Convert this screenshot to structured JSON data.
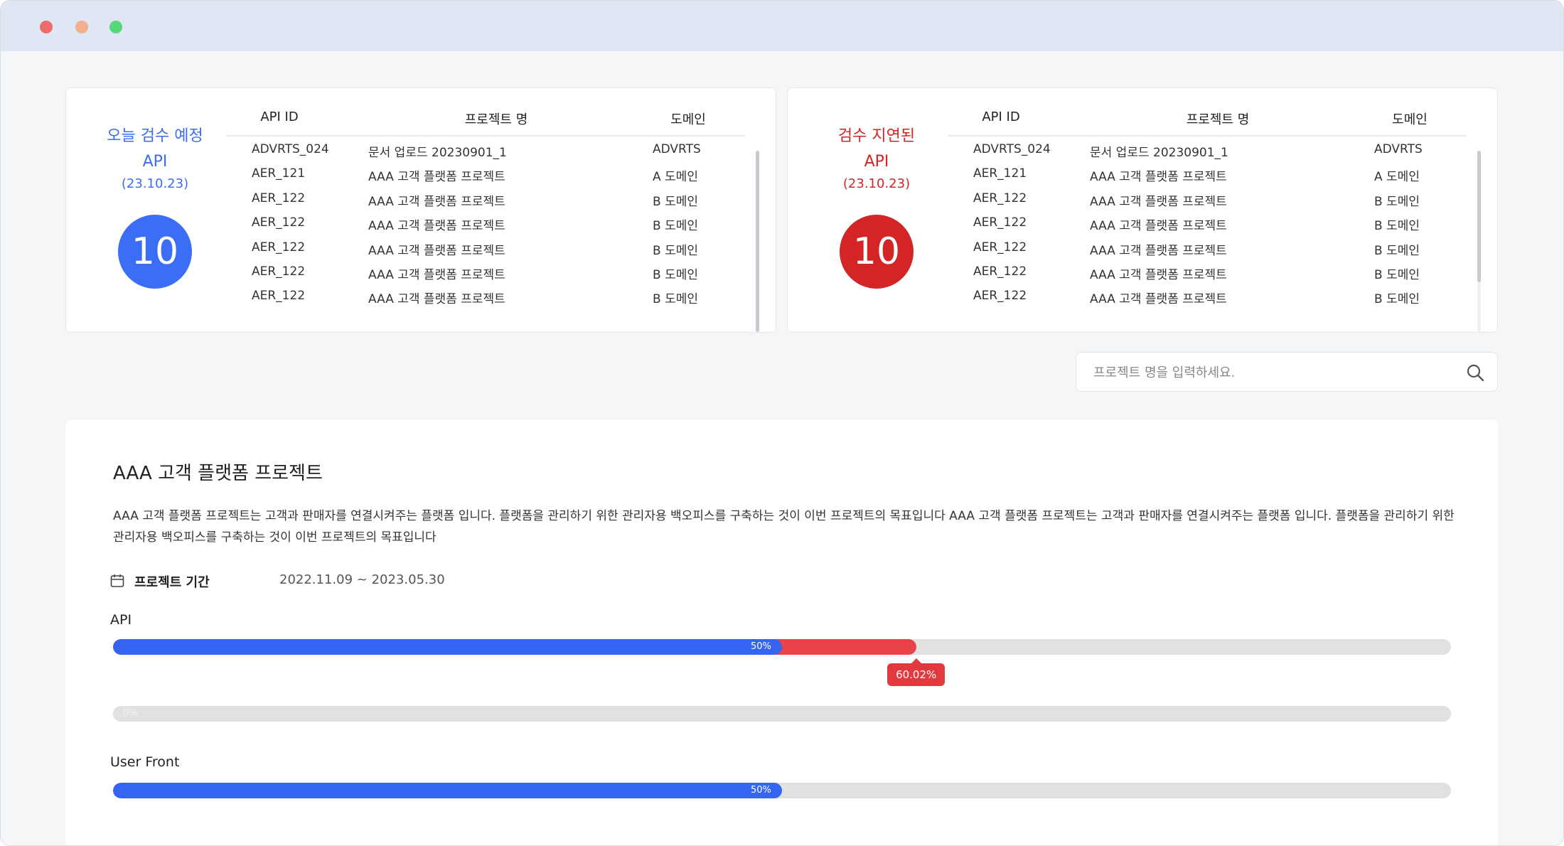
{
  "window": {
    "controls": {
      "close_color": "#ee6b6b",
      "minimize_color": "#f3b08c",
      "maximize_color": "#55d97a"
    }
  },
  "colors": {
    "blue": "#3b6ef5",
    "red": "#d32426"
  },
  "table_headers": {
    "api_id": "API ID",
    "project_name": "프로젝트 명",
    "domain": "도메인"
  },
  "scheduled_card": {
    "label_line1": "오늘 검수 예정",
    "label_line2": "API",
    "date": "(23.10.23)",
    "count": "10",
    "rows": [
      {
        "api_id": "ADVRTS_024",
        "project": "문서 업로드 20230901_1",
        "domain": "ADVRTS"
      },
      {
        "api_id": "AER_121",
        "project": "AAA 고객 플랫폼 프로젝트",
        "domain": "A 도메인"
      },
      {
        "api_id": "AER_122",
        "project": "AAA 고객 플랫폼 프로젝트",
        "domain": "B 도메인"
      },
      {
        "api_id": "AER_122",
        "project": "AAA 고객 플랫폼 프로젝트",
        "domain": "B 도메인"
      },
      {
        "api_id": "AER_122",
        "project": "AAA 고객 플랫폼 프로젝트",
        "domain": "B 도메인"
      },
      {
        "api_id": "AER_122",
        "project": "AAA 고객 플랫폼 프로젝트",
        "domain": "B 도메인"
      },
      {
        "api_id": "AER_122",
        "project": "AAA 고객 플랫폼 프로젝트",
        "domain": "B 도메인"
      }
    ]
  },
  "delayed_card": {
    "label_line1": "검수 지연된",
    "label_line2": "API",
    "date": "(23.10.23)",
    "count": "10",
    "rows": [
      {
        "api_id": "ADVRTS_024",
        "project": "문서 업로드 20230901_1",
        "domain": "ADVRTS"
      },
      {
        "api_id": "AER_121",
        "project": "AAA 고객 플랫폼 프로젝트",
        "domain": "A 도메인"
      },
      {
        "api_id": "AER_122",
        "project": "AAA 고객 플랫폼 프로젝트",
        "domain": "B 도메인"
      },
      {
        "api_id": "AER_122",
        "project": "AAA 고객 플랫폼 프로젝트",
        "domain": "B 도메인"
      },
      {
        "api_id": "AER_122",
        "project": "AAA 고객 플랫폼 프로젝트",
        "domain": "B 도메인"
      },
      {
        "api_id": "AER_122",
        "project": "AAA 고객 플랫폼 프로젝트",
        "domain": "B 도메인"
      },
      {
        "api_id": "AER_122",
        "project": "AAA 고객 플랫폼 프로젝트",
        "domain": "B 도메인"
      }
    ]
  },
  "search": {
    "placeholder": "프로젝트 명을 입력하세요.",
    "icon": "search-icon"
  },
  "project": {
    "title": "AAA 고객 플랫폼 프로젝트",
    "description": "AAA 고객 플랫폼 프로젝트는 고객과 판매자를 연결시켜주는 플랫폼 입니다. 플랫폼을 관리하기 위한 관리자용 백오피스를 구축하는 것이 이번 프로젝트의 목표입니다 AAA 고객 플랫폼 프로젝트는 고객과 판매자를 연결시켜주는 플랫폼 입니다. 플랫폼을 관리하기 위한 관리자용 백오피스를 구축하는 것이 이번 프로젝트의 목표입니다",
    "period_label": "프로젝트 기간",
    "period_value": "2022.11.09 ~ 2023.05.30",
    "period_icon": "calendar-icon",
    "api": {
      "label": "API",
      "progress_fraction": 0.5,
      "progress_text": "50%",
      "target_fraction": 0.6002,
      "target_text": "60.02%"
    },
    "second_bar": {
      "progress_fraction": 0,
      "progress_text": "0%"
    },
    "user_front": {
      "label": "User Front",
      "progress_fraction": 0.5,
      "progress_text": "50%"
    }
  }
}
